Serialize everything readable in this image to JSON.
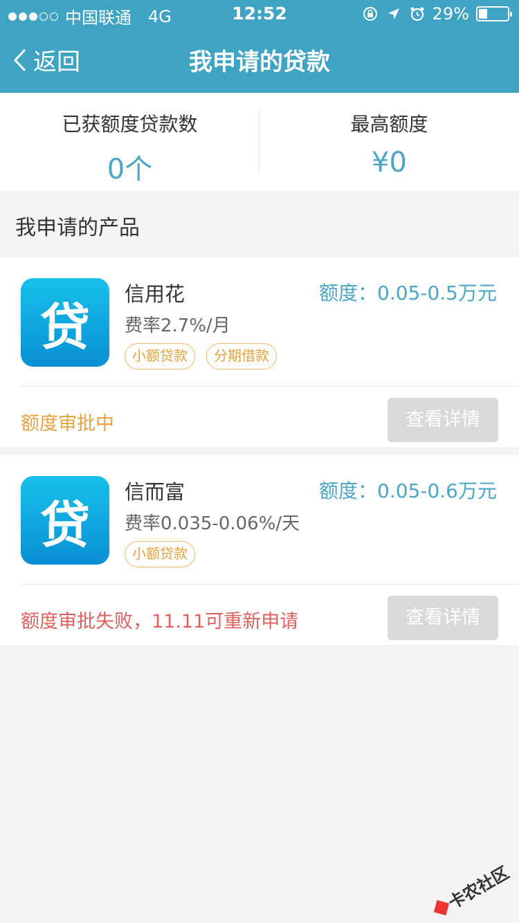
{
  "status_bar": {
    "carrier": "中国联通",
    "network": "4G",
    "time": "12:52",
    "battery_pct": "29%",
    "battery_level": 0.29
  },
  "nav": {
    "back_label": "返回",
    "title": "我申请的贷款"
  },
  "summary": {
    "left": {
      "label": "已获额度贷款数",
      "value": "0个"
    },
    "right": {
      "label": "最高额度",
      "value": "¥0"
    }
  },
  "section_title": "我申请的产品",
  "products": [
    {
      "logo_text": "贷",
      "name": "信用花",
      "rate": "费率2.7%/月",
      "quota": "额度：0.05-0.5万元",
      "tags": [
        "小额贷款",
        "分期借款"
      ],
      "status": "额度审批中",
      "detail_label": "查看详情"
    },
    {
      "logo_text": "贷",
      "name": "信而富",
      "rate": "费率0.035-0.06%/天",
      "quota": "额度：0.05-0.6万元",
      "tags": [
        "小额贷款"
      ],
      "status": "额度审批失败，11.11可重新申请",
      "detail_label": "查看详情"
    }
  ],
  "watermark": "卡农社区",
  "colors": {
    "header": "#3fa3c3",
    "accent": "#4aa6c4",
    "tag": "#e8a23f",
    "failed": "#e06060"
  }
}
